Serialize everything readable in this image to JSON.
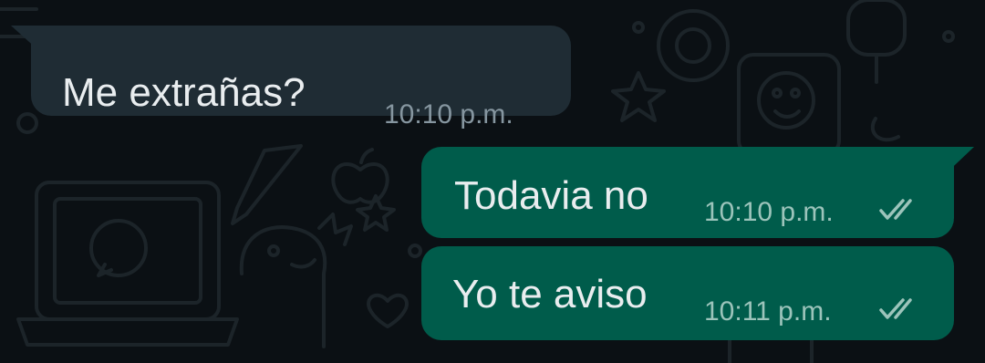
{
  "messages": [
    {
      "direction": "incoming",
      "text": "Me extrañas?",
      "time": "10:10 p.m."
    },
    {
      "direction": "outgoing",
      "text": "Todavia no",
      "time": "10:10 p.m.",
      "status": "read-double-check-icon"
    },
    {
      "direction": "outgoing",
      "text": "Yo te aviso",
      "time": "10:11 p.m.",
      "status": "read-double-check-icon"
    }
  ],
  "colors": {
    "background": "#0b1014",
    "incoming_bubble": "#1f2c34",
    "outgoing_bubble": "#005c4b",
    "message_text": "#e9edef",
    "incoming_time": "#8696a0",
    "outgoing_time": "#9cc4bb",
    "doodle": "#1a2126"
  }
}
